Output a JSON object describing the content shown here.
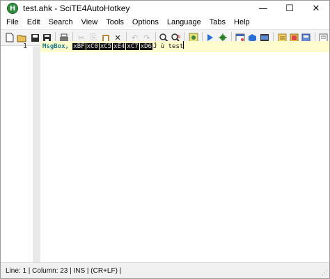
{
  "window": {
    "title": "test.ahk - SciTE4AutoHotkey",
    "icon_letter": "H"
  },
  "menu": [
    {
      "label": "File"
    },
    {
      "label": "Edit"
    },
    {
      "label": "Search"
    },
    {
      "label": "View"
    },
    {
      "label": "Tools"
    },
    {
      "label": "Options"
    },
    {
      "label": "Language"
    },
    {
      "label": "Tabs"
    },
    {
      "label": "Help"
    }
  ],
  "editor": {
    "line_number": "1",
    "code": {
      "keyword": "MsgBox,",
      "control_chars": [
        "xBF",
        "xC0",
        "xC5",
        "xE4",
        "xC7",
        "xD6"
      ],
      "tail": "Ĵ ù test"
    }
  },
  "status": {
    "text": "Line: 1 | Column: 23 | INS | (CR+LF) |"
  },
  "colors": {
    "caret_line": "#fffccd",
    "keyword": "#1a7a8c",
    "fold_margin": "#e9e9e9"
  }
}
